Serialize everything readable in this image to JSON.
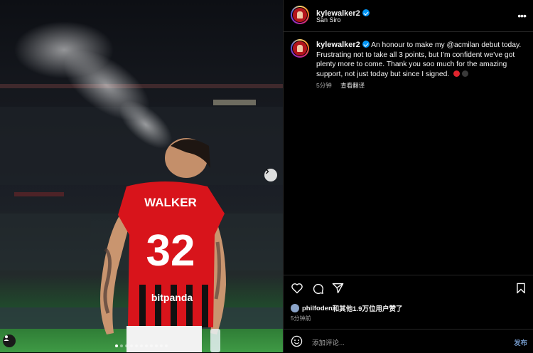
{
  "header": {
    "username": "kylewalker2",
    "location": "San Siro",
    "verified_icon": "verified-badge-icon",
    "more_icon": "more-options-icon"
  },
  "media": {
    "jersey_name": "WALKER",
    "jersey_number": "32",
    "sponsor": "bitpanda",
    "carousel_count": 11,
    "carousel_active": 0
  },
  "caption": {
    "username": "kylewalker2",
    "text": "An honour to make my @acmilan debut today. Frustrating not to take all 3 points, but I'm confident we've got plenty more to come. Thank you soo much for the amazing support, not just today but since I signed.",
    "time": "5分钟",
    "translate": "查看翻译"
  },
  "actions": {
    "like_icon": "heart-icon",
    "comment_icon": "comment-icon",
    "share_icon": "share-icon",
    "save_icon": "bookmark-icon"
  },
  "likes": {
    "liker": "philfoden",
    "rest": "和其他1.9万位用户赞了"
  },
  "timestamp": "5分钟前",
  "comment": {
    "placeholder": "添加评论...",
    "post_label": "发布"
  },
  "colors": {
    "accent": "#0095f6",
    "jersey_red": "#d8141b"
  }
}
